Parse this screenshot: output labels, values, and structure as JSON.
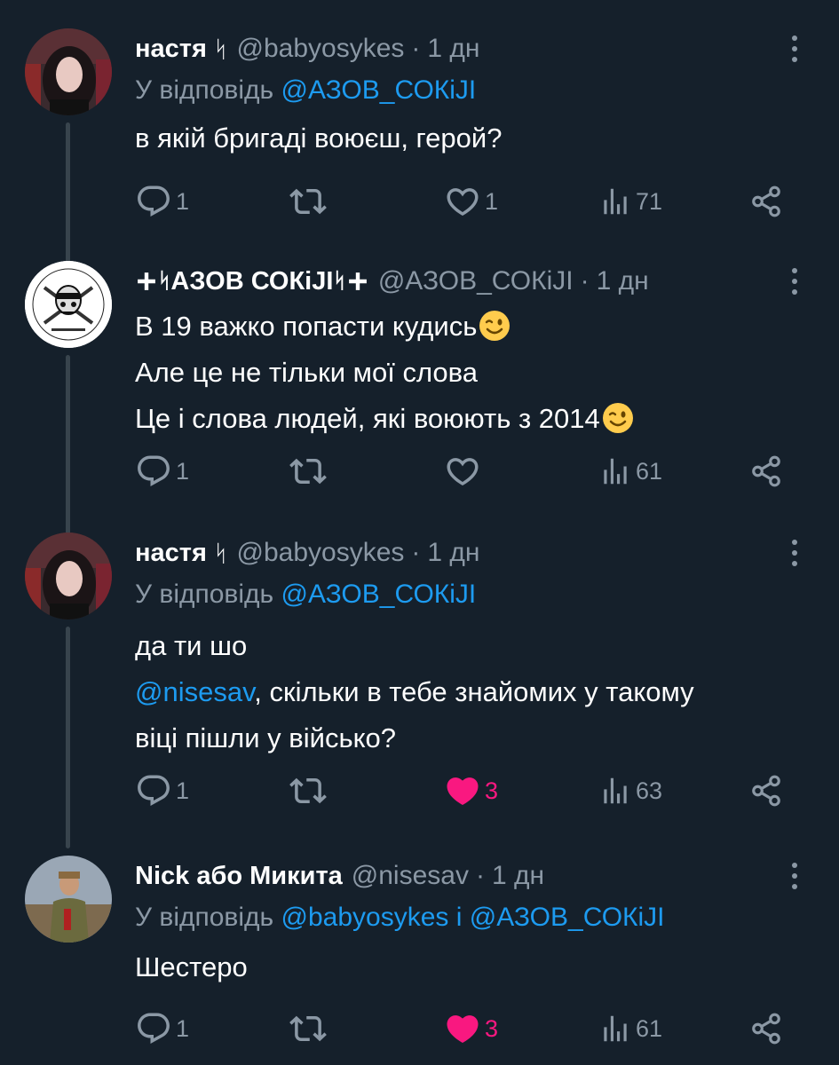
{
  "tweets": [
    {
      "name": "настя",
      "name_symbol": "ᛋ",
      "handle": "@babyosykes",
      "time": "1 дн",
      "reply_prefix": "У відповідь",
      "reply_to": [
        "@АЗОВ_СОКiJI"
      ],
      "reply_joiner": "",
      "lines": [
        "в якій бригаді воюєш, герой?"
      ],
      "replies": "1",
      "retweets": "",
      "likes": "1",
      "liked": false,
      "views": "71"
    },
    {
      "name": "АЗОВ СОКiJI",
      "handle": "@АЗОВ_СОКiJI",
      "time": "1 дн",
      "lines": [
        "В 19 важко попасти кудись",
        "Але це не тільки мої слова",
        "Це і слова людей, які воюють з 2014"
      ],
      "replies": "1",
      "retweets": "",
      "likes": "",
      "liked": false,
      "views": "61"
    },
    {
      "name": "настя",
      "name_symbol": "ᛋ",
      "handle": "@babyosykes",
      "time": "1 дн",
      "reply_prefix": "У відповідь",
      "reply_to": [
        "@АЗОВ_СОКiJI"
      ],
      "mention": "@nisesav",
      "lines": [
        "да ти шо",
        ", скільки в тебе знайомих у такому",
        "віці пішли у військо?"
      ],
      "replies": "1",
      "retweets": "",
      "likes": "3",
      "liked": true,
      "views": "63"
    },
    {
      "name": "Nick або Микита",
      "handle": "@nisesav",
      "time": "1 дн",
      "reply_prefix": "У відповідь",
      "reply_to": [
        "@babyosykes",
        "@АЗОВ_СОКiJI"
      ],
      "reply_joiner": "і",
      "lines": [
        "Шестеро"
      ],
      "replies": "1",
      "retweets": "",
      "likes": "3",
      "liked": true,
      "views": "61"
    }
  ],
  "icons": {
    "reply": "reply-icon",
    "retweet": "retweet-icon",
    "like": "heart-icon",
    "views": "views-icon",
    "share": "share-icon",
    "more": "more-options-icon",
    "wink": "winking-face-emoji"
  },
  "colors": {
    "background": "#15202b",
    "link": "#1d9bf0",
    "muted": "#8b98a5",
    "like": "#f91880"
  }
}
